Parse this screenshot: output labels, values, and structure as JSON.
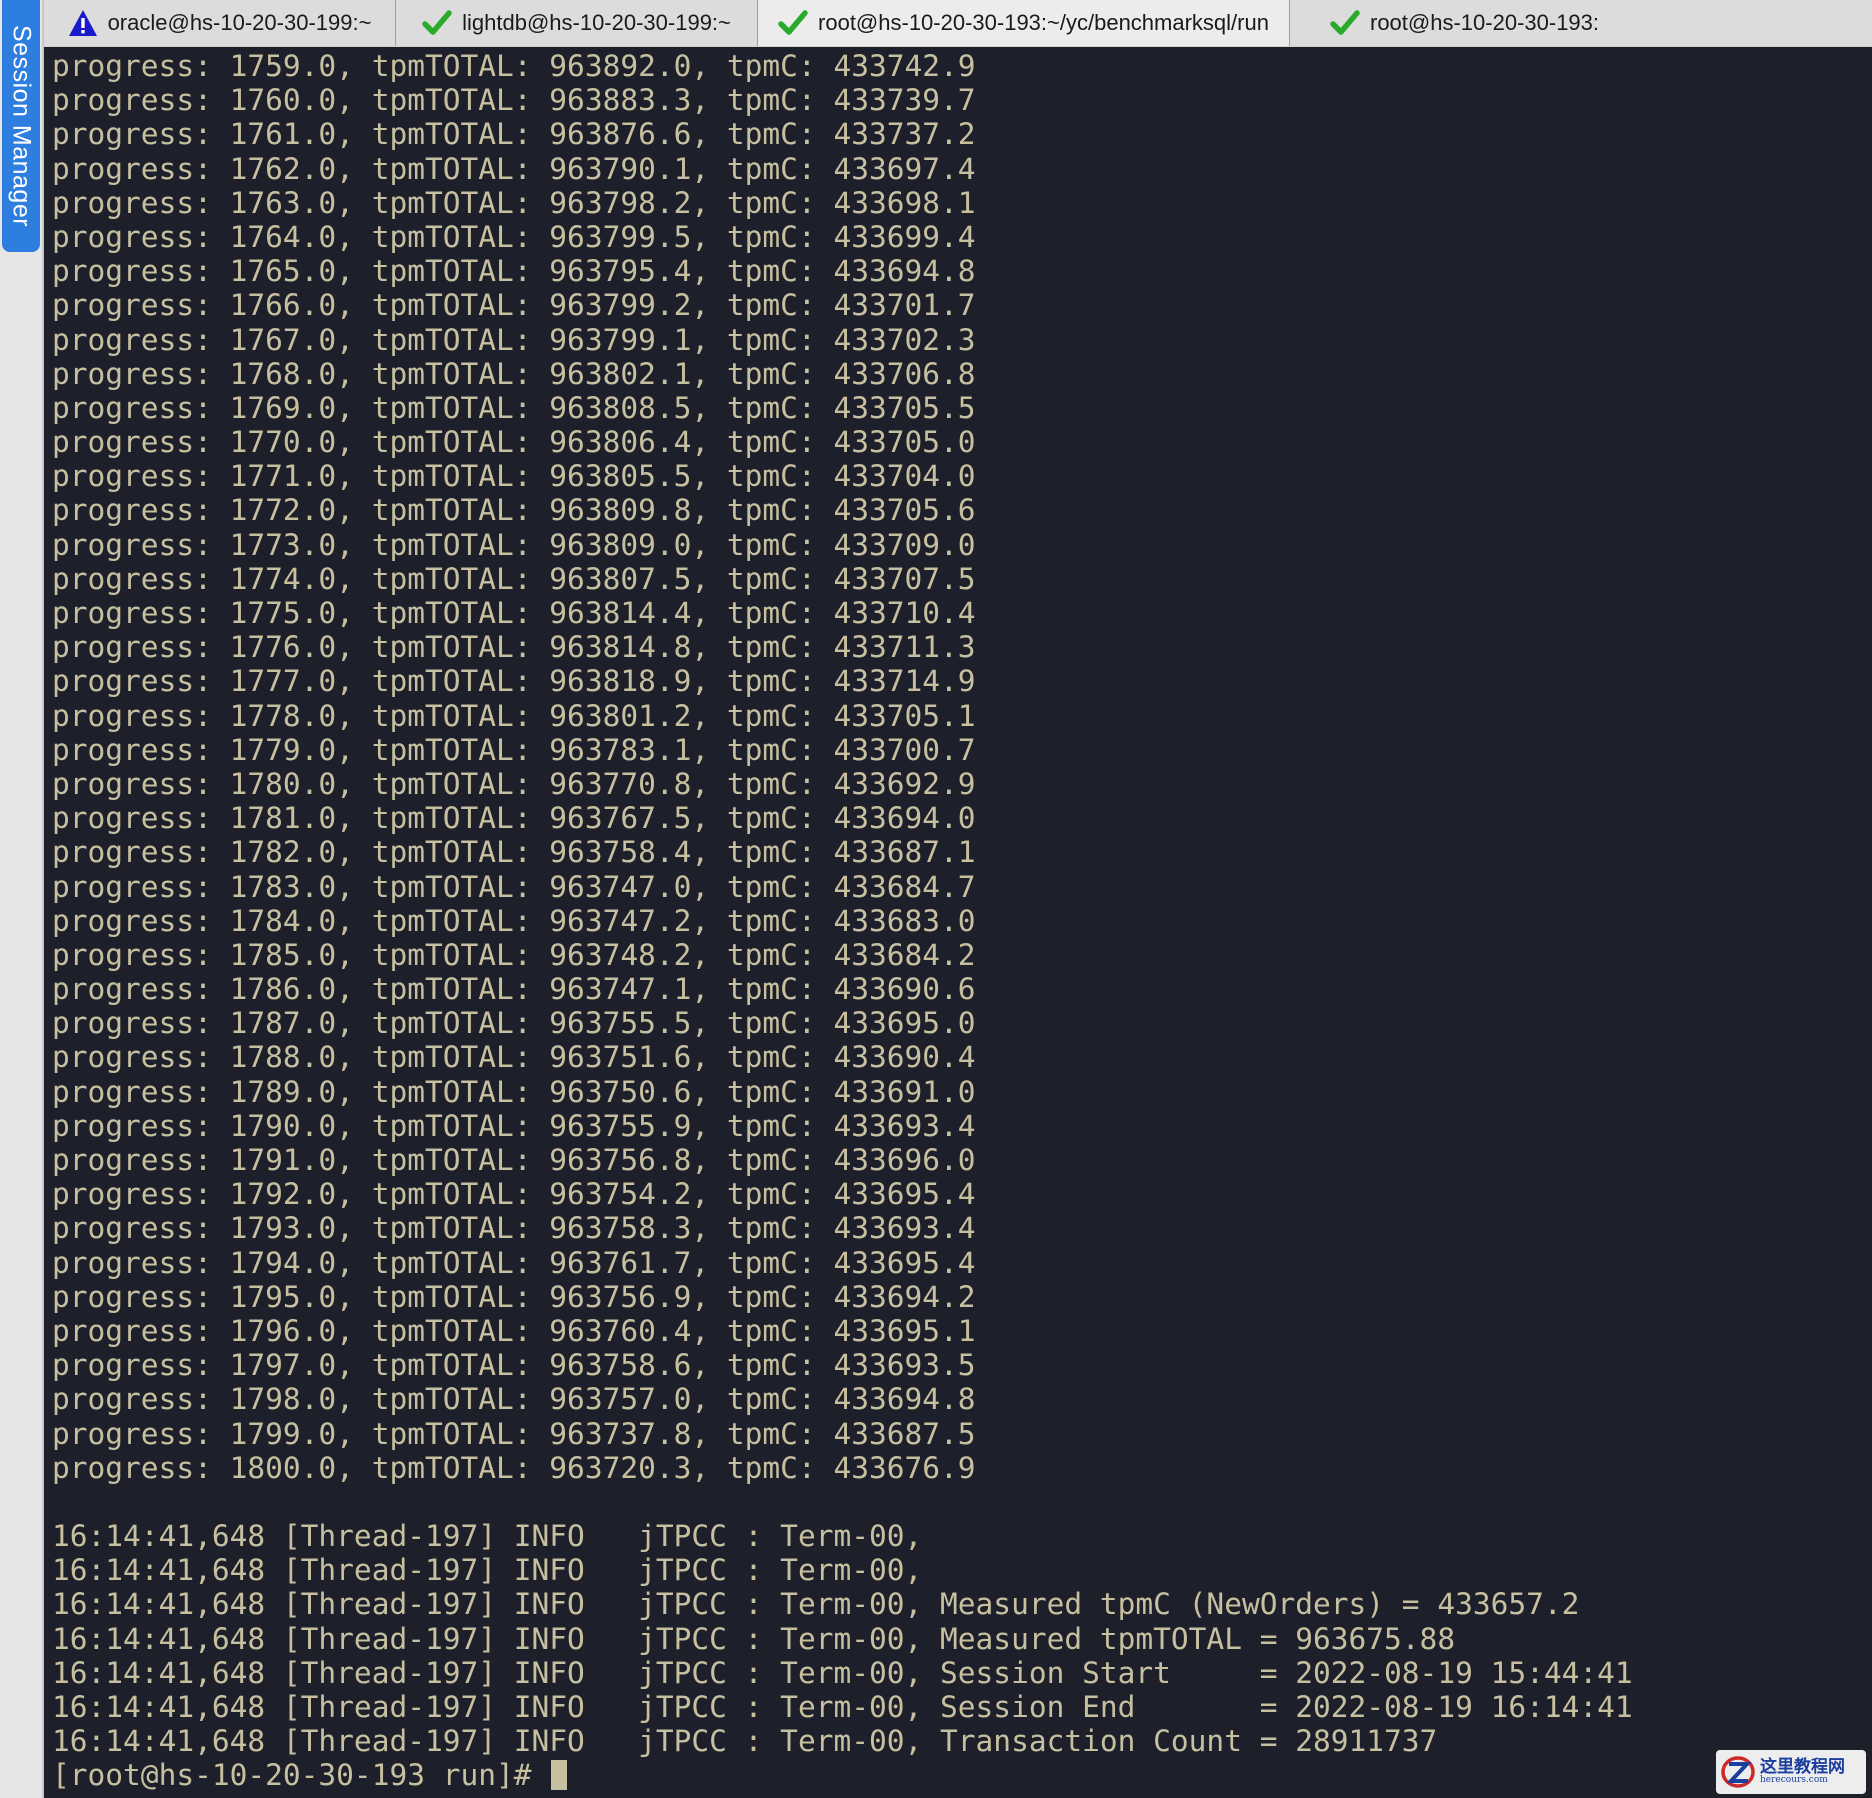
{
  "session_manager": {
    "label": "Session Manager"
  },
  "tabs": [
    {
      "title": "oracle@hs-10-20-30-199:~",
      "status": "warning",
      "icon": "warning-icon",
      "active": false
    },
    {
      "title": "lightdb@hs-10-20-30-199:~",
      "status": "ok",
      "icon": "check-icon",
      "active": false
    },
    {
      "title": "root@hs-10-20-30-193:~/yc/benchmarksql/run",
      "status": "ok",
      "icon": "check-icon",
      "active": true
    },
    {
      "title": "root@hs-10-20-30-193:",
      "status": "ok",
      "icon": "check-icon",
      "active": false
    }
  ],
  "colors": {
    "warning": "#1a1acc",
    "ok": "#2aaa2a",
    "terminal_text": "#c7c0a0",
    "terminal_bg": "#1d1f2a"
  },
  "terminal": {
    "lines": [
      "progress: 1759.0, tpmTOTAL: 963892.0, tpmC: 433742.9",
      "progress: 1760.0, tpmTOTAL: 963883.3, tpmC: 433739.7",
      "progress: 1761.0, tpmTOTAL: 963876.6, tpmC: 433737.2",
      "progress: 1762.0, tpmTOTAL: 963790.1, tpmC: 433697.4",
      "progress: 1763.0, tpmTOTAL: 963798.2, tpmC: 433698.1",
      "progress: 1764.0, tpmTOTAL: 963799.5, tpmC: 433699.4",
      "progress: 1765.0, tpmTOTAL: 963795.4, tpmC: 433694.8",
      "progress: 1766.0, tpmTOTAL: 963799.2, tpmC: 433701.7",
      "progress: 1767.0, tpmTOTAL: 963799.1, tpmC: 433702.3",
      "progress: 1768.0, tpmTOTAL: 963802.1, tpmC: 433706.8",
      "progress: 1769.0, tpmTOTAL: 963808.5, tpmC: 433705.5",
      "progress: 1770.0, tpmTOTAL: 963806.4, tpmC: 433705.0",
      "progress: 1771.0, tpmTOTAL: 963805.5, tpmC: 433704.0",
      "progress: 1772.0, tpmTOTAL: 963809.8, tpmC: 433705.6",
      "progress: 1773.0, tpmTOTAL: 963809.0, tpmC: 433709.0",
      "progress: 1774.0, tpmTOTAL: 963807.5, tpmC: 433707.5",
      "progress: 1775.0, tpmTOTAL: 963814.4, tpmC: 433710.4",
      "progress: 1776.0, tpmTOTAL: 963814.8, tpmC: 433711.3",
      "progress: 1777.0, tpmTOTAL: 963818.9, tpmC: 433714.9",
      "progress: 1778.0, tpmTOTAL: 963801.2, tpmC: 433705.1",
      "progress: 1779.0, tpmTOTAL: 963783.1, tpmC: 433700.7",
      "progress: 1780.0, tpmTOTAL: 963770.8, tpmC: 433692.9",
      "progress: 1781.0, tpmTOTAL: 963767.5, tpmC: 433694.0",
      "progress: 1782.0, tpmTOTAL: 963758.4, tpmC: 433687.1",
      "progress: 1783.0, tpmTOTAL: 963747.0, tpmC: 433684.7",
      "progress: 1784.0, tpmTOTAL: 963747.2, tpmC: 433683.0",
      "progress: 1785.0, tpmTOTAL: 963748.2, tpmC: 433684.2",
      "progress: 1786.0, tpmTOTAL: 963747.1, tpmC: 433690.6",
      "progress: 1787.0, tpmTOTAL: 963755.5, tpmC: 433695.0",
      "progress: 1788.0, tpmTOTAL: 963751.6, tpmC: 433690.4",
      "progress: 1789.0, tpmTOTAL: 963750.6, tpmC: 433691.0",
      "progress: 1790.0, tpmTOTAL: 963755.9, tpmC: 433693.4",
      "progress: 1791.0, tpmTOTAL: 963756.8, tpmC: 433696.0",
      "progress: 1792.0, tpmTOTAL: 963754.2, tpmC: 433695.4",
      "progress: 1793.0, tpmTOTAL: 963758.3, tpmC: 433693.4",
      "progress: 1794.0, tpmTOTAL: 963761.7, tpmC: 433695.4",
      "progress: 1795.0, tpmTOTAL: 963756.9, tpmC: 433694.2",
      "progress: 1796.0, tpmTOTAL: 963760.4, tpmC: 433695.1",
      "progress: 1797.0, tpmTOTAL: 963758.6, tpmC: 433693.5",
      "progress: 1798.0, tpmTOTAL: 963757.0, tpmC: 433694.8",
      "progress: 1799.0, tpmTOTAL: 963737.8, tpmC: 433687.5",
      "progress: 1800.0, tpmTOTAL: 963720.3, tpmC: 433676.9",
      "",
      "16:14:41,648 [Thread-197] INFO   jTPCC : Term-00,",
      "16:14:41,648 [Thread-197] INFO   jTPCC : Term-00,",
      "16:14:41,648 [Thread-197] INFO   jTPCC : Term-00, Measured tpmC (NewOrders) = 433657.2",
      "16:14:41,648 [Thread-197] INFO   jTPCC : Term-00, Measured tpmTOTAL = 963675.88",
      "16:14:41,648 [Thread-197] INFO   jTPCC : Term-00, Session Start     = 2022-08-19 15:44:41",
      "16:14:41,648 [Thread-197] INFO   jTPCC : Term-00, Session End       = 2022-08-19 16:14:41",
      "16:14:41,648 [Thread-197] INFO   jTPCC : Term-00, Transaction Count = 28911737"
    ],
    "prompt": "[root@hs-10-20-30-193 run]# "
  },
  "watermark": {
    "main": "这里教程网",
    "sub": "herecours.com"
  }
}
